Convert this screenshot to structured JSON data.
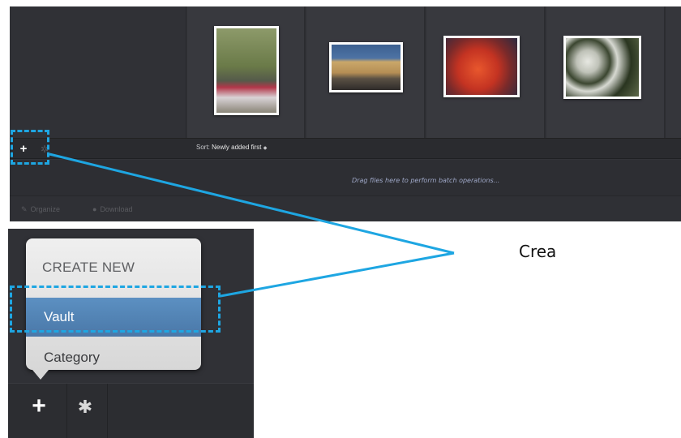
{
  "library": {
    "thumbnails": [
      {
        "name": "tools-on-table",
        "colors": [
          "#6a7a48",
          "#b3374a",
          "#8a8578"
        ]
      },
      {
        "name": "building-exterior",
        "colors": [
          "#3b5f90",
          "#c9a76a",
          "#5a5044"
        ]
      },
      {
        "name": "crawfish-plate",
        "colors": [
          "#c43322",
          "#e8572d",
          "#2b2a40"
        ]
      },
      {
        "name": "white-flowers",
        "colors": [
          "#2a3520",
          "#d7d9d2",
          "#5e6a4a"
        ]
      }
    ]
  },
  "toolbar": {
    "add_icon": "+",
    "settings_icon": "gear-icon",
    "sort_label": "Sort:",
    "sort_value": "Newly added first",
    "sort_arrow": "◆"
  },
  "drop_zone": {
    "text": "Drag files here to perform batch operations..."
  },
  "bottom_bar": {
    "organize_label": "Organize",
    "download_label": "Download"
  },
  "popup": {
    "header": "CREATE NEW",
    "items": [
      {
        "label": "Vault",
        "selected": true
      },
      {
        "label": "Category",
        "selected": false
      }
    ]
  },
  "zoom_bar": {
    "add_icon": "+",
    "settings_icon": "gear-icon"
  },
  "annotation": {
    "callout_text": "Crea",
    "color": "#1ea6e2"
  }
}
